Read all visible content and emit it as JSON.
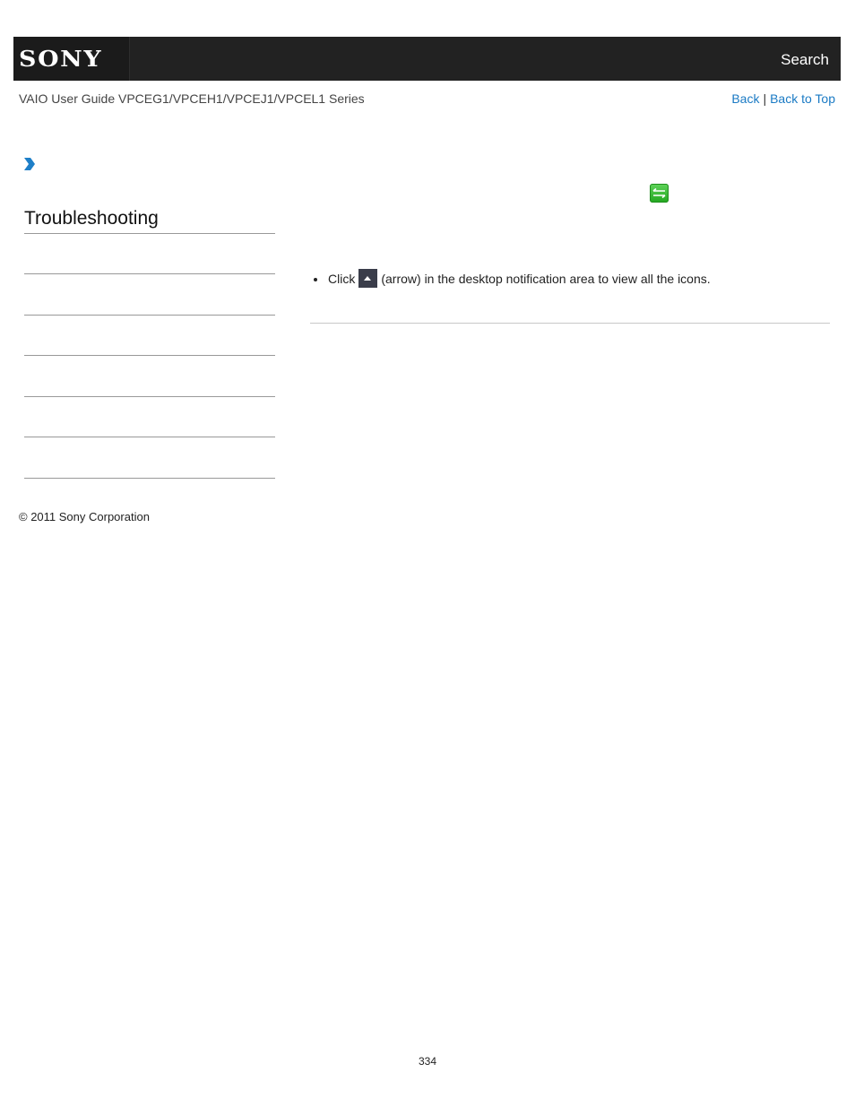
{
  "header": {
    "logo_text": "SONY",
    "search_label": "Search"
  },
  "subheader": {
    "guide_title": "VAIO User Guide VPCEG1/VPCEH1/VPCEJ1/VPCEL1 Series",
    "back_label": "Back",
    "separator": "|",
    "back_to_top_label": "Back to Top"
  },
  "breadcrumb": {
    "icon": "chevron-right-icon"
  },
  "main": {
    "status_icon": "green-sync-arrows-icon",
    "bullets": [
      {
        "before": "Click",
        "icon": "up-arrow-icon",
        "after": "(arrow) in the desktop notification area to view all the icons."
      }
    ]
  },
  "sidebar": {
    "title": "Troubleshooting",
    "item_count": 6
  },
  "footer": {
    "copyright": "© 2011 Sony Corporation",
    "page_number": "334"
  },
  "colors": {
    "header_bg": "#222222",
    "link": "#1a7ac4",
    "chevron": "#1e7fc8",
    "status_icon_green": "#2fb52b"
  }
}
